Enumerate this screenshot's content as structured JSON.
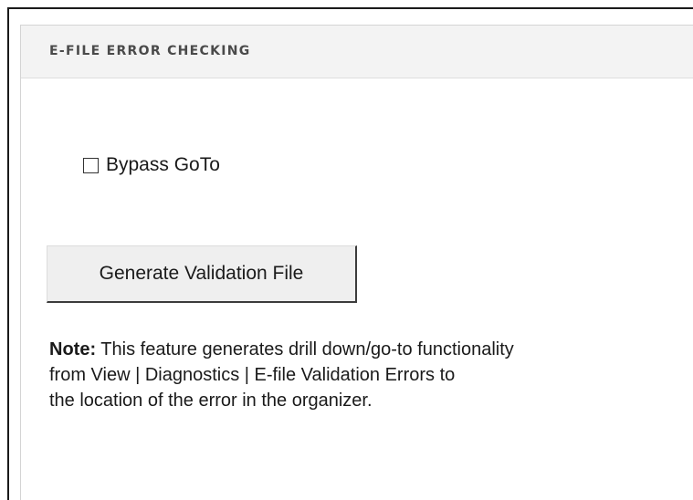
{
  "panel": {
    "title": "E-FILE ERROR CHECKING"
  },
  "options": {
    "bypass_goto_label": "Bypass GoTo",
    "bypass_goto_checked": false
  },
  "actions": {
    "generate_label": "Generate Validation File"
  },
  "note": {
    "label": "Note:",
    "line1": " This feature generates drill down/go-to functionality",
    "line2": "from View | Diagnostics | E-file Validation Errors to",
    "line3": "the location of the error in the organizer."
  }
}
